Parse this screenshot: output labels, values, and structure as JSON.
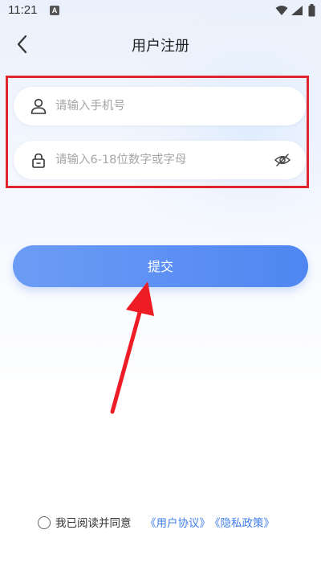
{
  "status_bar": {
    "time": "11:21",
    "notification_badge": "A",
    "icons": [
      "wifi-icon",
      "signal-icon",
      "battery-icon"
    ]
  },
  "header": {
    "back_icon": "chevron-left-icon",
    "title": "用户注册"
  },
  "form": {
    "phone": {
      "icon": "user-icon",
      "placeholder": "请输入手机号",
      "value": ""
    },
    "password": {
      "icon": "lock-icon",
      "placeholder": "请输入6-18位数字或字母",
      "value": "",
      "toggle_icon": "eye-off-icon"
    },
    "submit_label": "提交"
  },
  "agreement": {
    "text": "我已阅读并同意",
    "user_agreement": "《用户协议》",
    "privacy_policy": "《隐私政策》",
    "checked": false
  },
  "annotations": {
    "highlight_color": "#e0262c",
    "arrow_color": "#ee1c25"
  },
  "colors": {
    "accent": "#5e91f4",
    "link": "#3f7de8"
  }
}
